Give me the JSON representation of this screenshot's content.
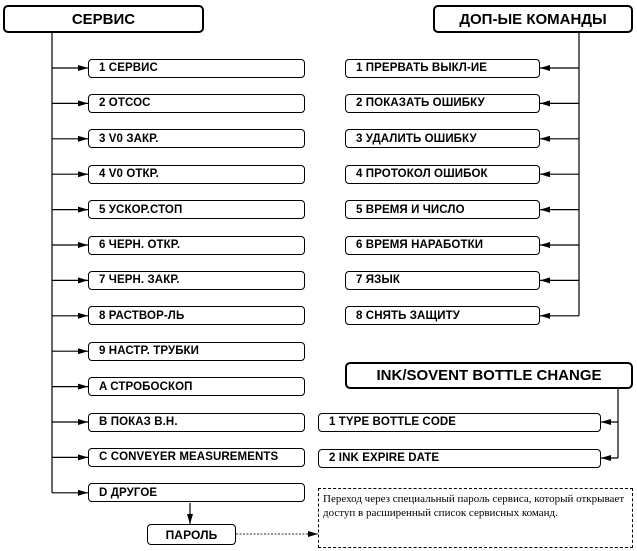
{
  "service": {
    "title": "СЕРВИС",
    "items": [
      "1  СЕРВИС",
      "2  ОТСОС",
      "3  V0 ЗАКР.",
      "4  V0 ОТКР.",
      "5  УСКОР.СТОП",
      "6  ЧЕРН. ОТКР.",
      "7  ЧЕРН. ЗАКР.",
      "8  РАСТВОР-ЛЬ",
      "9  НАСТР. ТРУБКИ",
      "A  СТРОБОСКОП",
      "B  ПОКАЗ В.Н.",
      "C  CONVEYER MEASUREMENTS",
      "D  ДРУГОЕ"
    ],
    "password": "ПАРОЛЬ"
  },
  "extra": {
    "title": "ДОП-ЫЕ КОМАНДЫ",
    "items": [
      "1  ПРЕРВАТЬ ВЫКЛ-ИЕ",
      "2  ПОКАЗАТЬ ОШИБКУ",
      "3  УДАЛИТЬ ОШИБКУ",
      "4  ПРОТОКОЛ ОШИБОК",
      "5  ВРЕМЯ И ЧИСЛО",
      "6  ВРЕМЯ НАРАБОТКИ",
      "7  ЯЗЫК",
      "8  СНЯТЬ ЗАЩИТУ"
    ]
  },
  "ink": {
    "title": "INK/SOVENT BOTTLE CHANGE",
    "items": [
      "1 TYPE BOTTLE CODE",
      "2 INK EXPIRE DATE"
    ]
  },
  "note": "Переход через специальный пароль сервиса, который открывает доступ в расширенный список сервисных команд."
}
